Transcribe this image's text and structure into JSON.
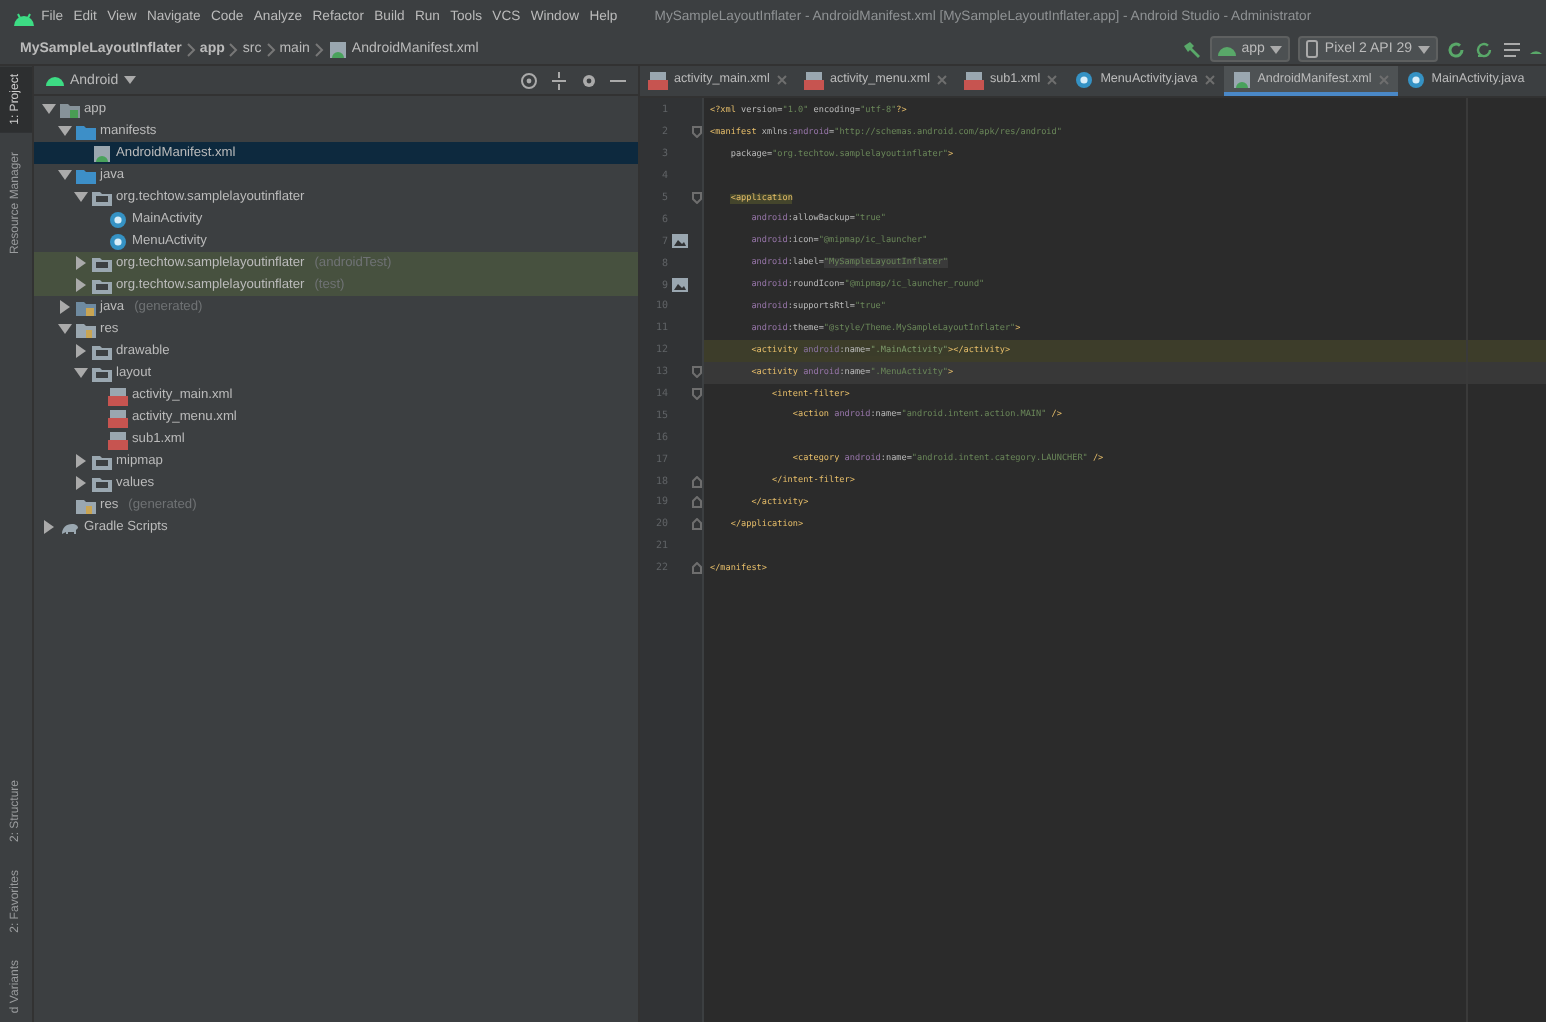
{
  "window": {
    "title": "MySampleLayoutInflater - AndroidManifest.xml [MySampleLayoutInflater.app] - Android Studio - Administrator"
  },
  "menu": [
    "File",
    "Edit",
    "View",
    "Navigate",
    "Code",
    "Analyze",
    "Refactor",
    "Build",
    "Run",
    "Tools",
    "VCS",
    "Window",
    "Help"
  ],
  "breadcrumbs": [
    {
      "label": "MySampleLayoutInflater",
      "kind": "bold"
    },
    {
      "label": "app",
      "kind": "bold"
    },
    {
      "label": "src",
      "kind": "plain"
    },
    {
      "label": "main",
      "kind": "plain"
    },
    {
      "label": "AndroidManifest.xml",
      "kind": "file"
    }
  ],
  "run_config": {
    "label": "app"
  },
  "device": {
    "label": "Pixel 2 API 29"
  },
  "side_tabs_top": [
    {
      "label": "1: Project",
      "selected": true
    },
    {
      "label": "Resource Manager",
      "selected": false
    }
  ],
  "side_tabs_bottom": [
    {
      "label": "2: Structure",
      "selected": false
    },
    {
      "label": "2: Favorites",
      "selected": false
    },
    {
      "label": "d Variants",
      "selected": false
    }
  ],
  "project_panel": {
    "view": "Android",
    "tree": [
      {
        "label": "app",
        "kind": "module",
        "expanded": true,
        "selected": false,
        "highlighted": false,
        "children": [
          {
            "label": "manifests",
            "kind": "source-folder",
            "expanded": true,
            "selected": false,
            "highlighted": false,
            "children": [
              {
                "label": "AndroidManifest.xml",
                "kind": "manifest",
                "selected": true,
                "highlighted": false
              }
            ]
          },
          {
            "label": "java",
            "kind": "source-folder",
            "expanded": true,
            "selected": false,
            "highlighted": false,
            "children": [
              {
                "label": "org.techtow.samplelayoutinflater",
                "kind": "package",
                "expanded": true,
                "selected": false,
                "highlighted": false,
                "children": [
                  {
                    "label": "MainActivity",
                    "kind": "class",
                    "selected": false,
                    "highlighted": false
                  },
                  {
                    "label": "MenuActivity",
                    "kind": "class",
                    "selected": false,
                    "highlighted": false
                  }
                ]
              },
              {
                "label": "org.techtow.samplelayoutinflater",
                "note": "(androidTest)",
                "kind": "package",
                "expanded": false,
                "selected": false,
                "highlighted": true
              },
              {
                "label": "org.techtow.samplelayoutinflater",
                "note": "(test)",
                "kind": "package",
                "expanded": false,
                "selected": false,
                "highlighted": true
              }
            ]
          },
          {
            "label": "java",
            "note": "(generated)",
            "kind": "generated",
            "expanded": false,
            "selected": false,
            "highlighted": false
          },
          {
            "label": "res",
            "kind": "resources",
            "expanded": true,
            "selected": false,
            "highlighted": false,
            "children": [
              {
                "label": "drawable",
                "kind": "package",
                "expanded": false,
                "selected": false,
                "highlighted": false
              },
              {
                "label": "layout",
                "kind": "package",
                "expanded": true,
                "selected": false,
                "highlighted": false,
                "children": [
                  {
                    "label": "activity_main.xml",
                    "kind": "layout",
                    "selected": false,
                    "highlighted": false
                  },
                  {
                    "label": "activity_menu.xml",
                    "kind": "layout",
                    "selected": false,
                    "highlighted": false
                  },
                  {
                    "label": "sub1.xml",
                    "kind": "layout",
                    "selected": false,
                    "highlighted": false
                  }
                ]
              },
              {
                "label": "mipmap",
                "kind": "package",
                "expanded": false,
                "selected": false,
                "highlighted": false
              },
              {
                "label": "values",
                "kind": "package",
                "expanded": false,
                "selected": false,
                "highlighted": false
              }
            ]
          },
          {
            "label": "res",
            "note": "(generated)",
            "kind": "resources",
            "selected": false,
            "highlighted": false
          }
        ]
      },
      {
        "label": "Gradle Scripts",
        "kind": "gradle",
        "expanded": false,
        "selected": false,
        "highlighted": false
      }
    ]
  },
  "editor": {
    "tabs": [
      {
        "label": "activity_main.xml",
        "kind": "layout",
        "selected": false,
        "closable": true
      },
      {
        "label": "activity_menu.xml",
        "kind": "layout",
        "selected": false,
        "closable": true
      },
      {
        "label": "sub1.xml",
        "kind": "layout",
        "selected": false,
        "closable": true
      },
      {
        "label": "MenuActivity.java",
        "kind": "class",
        "selected": false,
        "closable": true
      },
      {
        "label": "AndroidManifest.xml",
        "kind": "manifest",
        "selected": true,
        "closable": true
      },
      {
        "label": "MainActivity.java",
        "kind": "class",
        "selected": false,
        "closable": false
      }
    ],
    "lines": [
      {
        "number": "1",
        "kind": "plain",
        "current": false,
        "marked": false,
        "tokens": [
          {
            "kind": "tag",
            "text": "<?xml "
          },
          {
            "kind": "attr",
            "text": "version="
          },
          {
            "kind": "value",
            "text": "\"1.0\" "
          },
          {
            "kind": "attr",
            "text": "encoding="
          },
          {
            "kind": "value",
            "text": "\"utf-8\""
          },
          {
            "kind": "tag",
            "text": "?>"
          }
        ]
      },
      {
        "number": "2",
        "kind": "fold-start",
        "current": false,
        "marked": false,
        "tokens": [
          {
            "kind": "tag",
            "text": "<manifest "
          },
          {
            "kind": "attr",
            "text": "xmlns"
          },
          {
            "kind": "ns",
            "text": ":android"
          },
          {
            "kind": "attr",
            "text": "="
          },
          {
            "kind": "value",
            "text": "\"http://schemas.android.com/apk/res/android\""
          }
        ]
      },
      {
        "number": "3",
        "kind": "plain",
        "current": false,
        "marked": false,
        "tokens": [
          {
            "kind": "attr",
            "text": "    package="
          },
          {
            "kind": "value",
            "text": "\"org.techtow.samplelayoutinflater\""
          },
          {
            "kind": "tag",
            "text": ">"
          }
        ]
      },
      {
        "number": "4",
        "kind": "plain",
        "current": false,
        "marked": false
      },
      {
        "number": "5",
        "kind": "fold-start",
        "current": false,
        "marked": false,
        "tokens": [
          {
            "kind": "tag-marked",
            "text": "    <application"
          }
        ]
      },
      {
        "number": "6",
        "kind": "plain",
        "current": false,
        "marked": false,
        "tokens": [
          {
            "kind": "ns",
            "text": "        android"
          },
          {
            "kind": "attr",
            "text": ":allowBackup="
          },
          {
            "kind": "value",
            "text": "\"true\""
          }
        ]
      },
      {
        "number": "7",
        "kind": "image",
        "current": false,
        "marked": false,
        "tokens": [
          {
            "kind": "ns",
            "text": "        android"
          },
          {
            "kind": "attr",
            "text": ":icon="
          },
          {
            "kind": "value",
            "text": "\"@mipmap/ic_launcher\""
          }
        ]
      },
      {
        "number": "8",
        "kind": "plain",
        "current": false,
        "marked": false,
        "tokens": [
          {
            "kind": "ns",
            "text": "        android"
          },
          {
            "kind": "attr",
            "text": ":label="
          },
          {
            "kind": "value-boxed",
            "text": "\"MySampleLayoutInflater\""
          }
        ]
      },
      {
        "number": "9",
        "kind": "image",
        "current": false,
        "marked": false,
        "tokens": [
          {
            "kind": "ns",
            "text": "        android"
          },
          {
            "kind": "attr",
            "text": ":roundIcon="
          },
          {
            "kind": "value",
            "text": "\"@mipmap/ic_launcher_round\""
          }
        ]
      },
      {
        "number": "10",
        "kind": "plain",
        "current": false,
        "marked": false,
        "tokens": [
          {
            "kind": "ns",
            "text": "        android"
          },
          {
            "kind": "attr",
            "text": ":supportsRtl="
          },
          {
            "kind": "value",
            "text": "\"true\""
          }
        ]
      },
      {
        "number": "11",
        "kind": "plain",
        "current": false,
        "marked": false,
        "tokens": [
          {
            "kind": "ns",
            "text": "        android"
          },
          {
            "kind": "attr",
            "text": ":theme="
          },
          {
            "kind": "value",
            "text": "\"@style/Theme.MySampleLayoutInflater\""
          },
          {
            "kind": "tag",
            "text": ">"
          }
        ]
      },
      {
        "number": "12",
        "kind": "plain",
        "current": false,
        "marked": true,
        "tokens": [
          {
            "kind": "tag",
            "text": "        <activity "
          },
          {
            "kind": "ns-dim",
            "text": "android"
          },
          {
            "kind": "attr",
            "text": ":name="
          },
          {
            "kind": "value-dim",
            "text": "\".MainActivity\""
          },
          {
            "kind": "tag",
            "text": "></activity>"
          }
        ]
      },
      {
        "number": "13",
        "kind": "fold-start",
        "current": true,
        "marked": false,
        "tokens": [
          {
            "kind": "tag",
            "text": "        <activity "
          },
          {
            "kind": "ns",
            "text": "android"
          },
          {
            "kind": "attr",
            "text": ":name="
          },
          {
            "kind": "value",
            "text": "\".MenuActivity\""
          },
          {
            "kind": "tag",
            "text": ">"
          }
        ]
      },
      {
        "number": "14",
        "kind": "fold-start",
        "current": false,
        "marked": false,
        "tokens": [
          {
            "kind": "tag",
            "text": "            <intent-filter>"
          }
        ]
      },
      {
        "number": "15",
        "kind": "plain",
        "current": false,
        "marked": false,
        "tokens": [
          {
            "kind": "tag",
            "text": "                <action "
          },
          {
            "kind": "ns",
            "text": "android"
          },
          {
            "kind": "attr",
            "text": ":name="
          },
          {
            "kind": "value",
            "text": "\"android.intent.action.MAIN\" "
          },
          {
            "kind": "tag",
            "text": "/>"
          }
        ]
      },
      {
        "number": "16",
        "kind": "plain",
        "current": false,
        "marked": false
      },
      {
        "number": "17",
        "kind": "plain",
        "current": false,
        "marked": false,
        "tokens": [
          {
            "kind": "tag",
            "text": "                <category "
          },
          {
            "kind": "ns",
            "text": "android"
          },
          {
            "kind": "attr",
            "text": ":name="
          },
          {
            "kind": "value",
            "text": "\"android.intent.category.LAUNCHER\" "
          },
          {
            "kind": "tag",
            "text": "/>"
          }
        ]
      },
      {
        "number": "18",
        "kind": "fold-end",
        "current": false,
        "marked": false,
        "tokens": [
          {
            "kind": "tag",
            "text": "            </intent-filter>"
          }
        ]
      },
      {
        "number": "19",
        "kind": "fold-end",
        "current": false,
        "marked": false,
        "tokens": [
          {
            "kind": "tag",
            "text": "        </activity>"
          }
        ]
      },
      {
        "number": "20",
        "kind": "fold-end",
        "current": false,
        "marked": false,
        "tokens": [
          {
            "kind": "tag",
            "text": "    </application>"
          }
        ]
      },
      {
        "number": "21",
        "kind": "plain",
        "current": false,
        "marked": false
      },
      {
        "number": "22",
        "kind": "fold-end",
        "current": false,
        "marked": false,
        "tokens": [
          {
            "kind": "tag",
            "text": "</manifest>"
          }
        ]
      }
    ]
  }
}
